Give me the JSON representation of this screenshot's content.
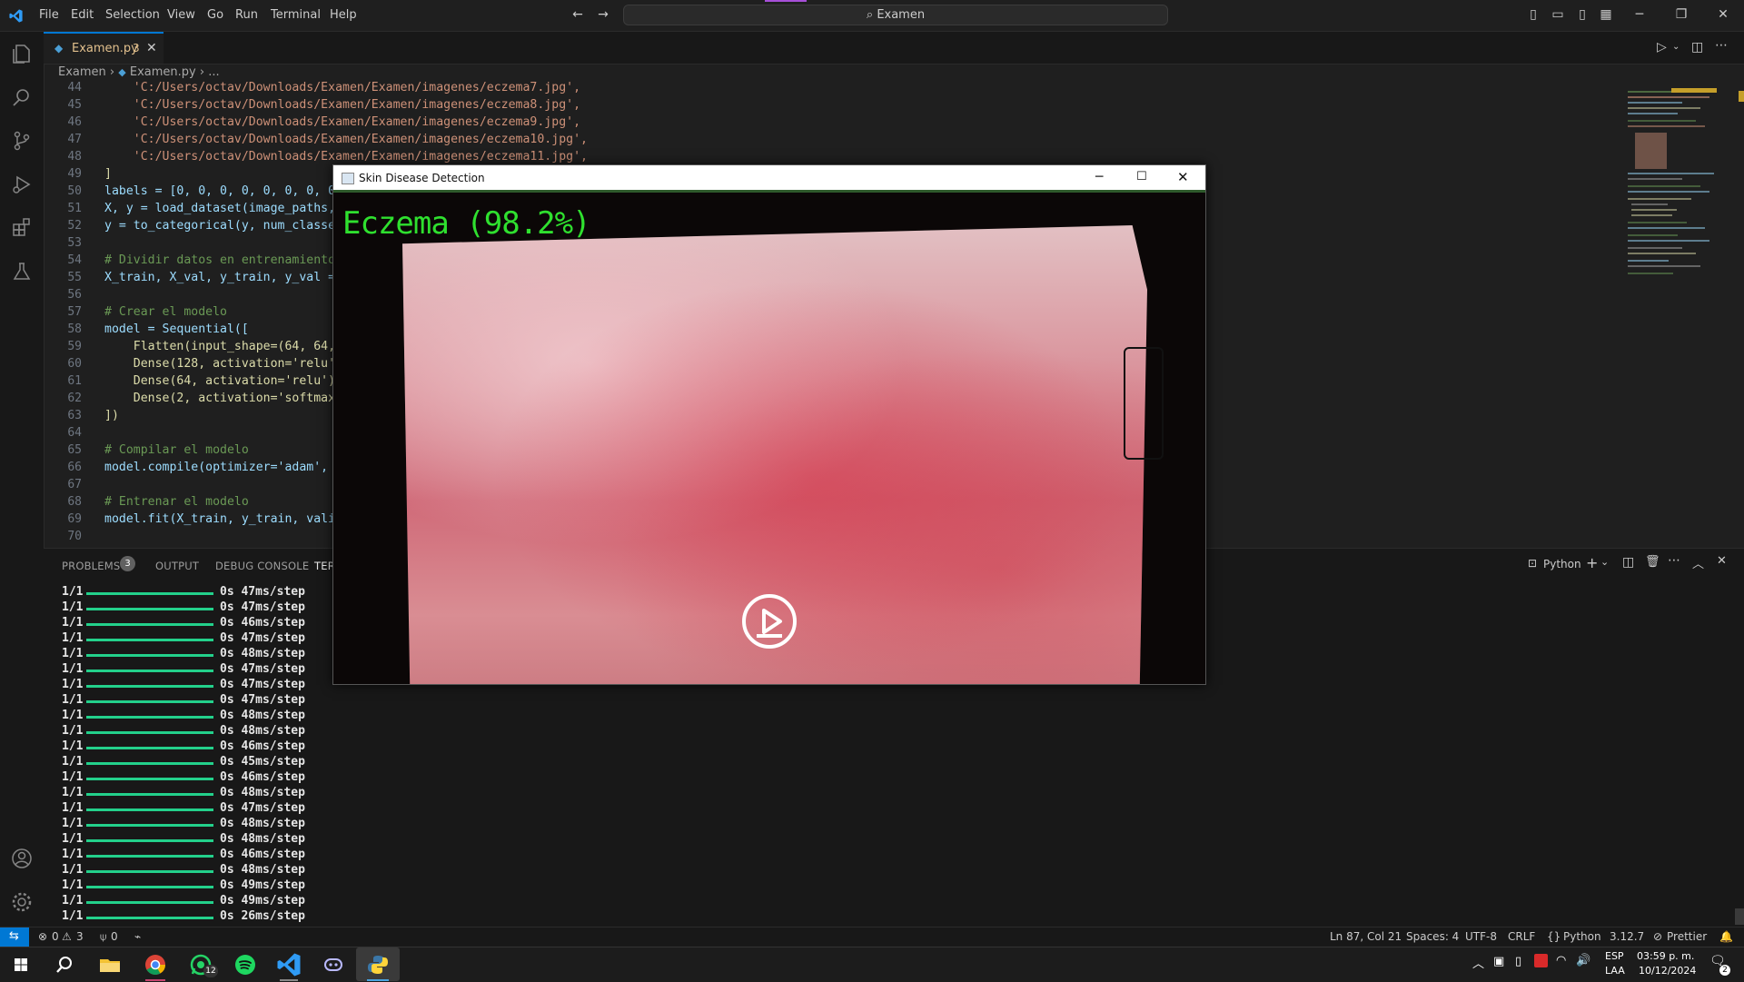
{
  "app": {
    "menu": [
      "File",
      "Edit",
      "Selection",
      "View",
      "Go",
      "Run",
      "Terminal",
      "Help"
    ],
    "search": "Examen",
    "accent": "#0078d4"
  },
  "tab": {
    "name": "Examen.py",
    "badge": "3"
  },
  "breadcrumb": {
    "folder": "Examen",
    "file": "Examen.py",
    "more": "..."
  },
  "editor": {
    "lines": [
      {
        "n": "44",
        "text": "    'C:/Users/octav/Downloads/Examen/Examen/imagenes/eczema7.jpg',",
        "cls": "str"
      },
      {
        "n": "45",
        "text": "    'C:/Users/octav/Downloads/Examen/Examen/imagenes/eczema8.jpg',",
        "cls": "str"
      },
      {
        "n": "46",
        "text": "    'C:/Users/octav/Downloads/Examen/Examen/imagenes/eczema9.jpg',",
        "cls": "str"
      },
      {
        "n": "47",
        "text": "    'C:/Users/octav/Downloads/Examen/Examen/imagenes/eczema10.jpg',",
        "cls": "str"
      },
      {
        "n": "48",
        "text": "    'C:/Users/octav/Downloads/Examen/Examen/imagenes/eczema11.jpg',",
        "cls": "str"
      },
      {
        "n": "49",
        "text": "]",
        "cls": "fn"
      },
      {
        "n": "50",
        "text": "labels = [0, 0, 0, 0, 0, 0, 0, 0,",
        "cls": "var"
      },
      {
        "n": "51",
        "text": "X, y = load_dataset(image_paths,",
        "cls": "var"
      },
      {
        "n": "52",
        "text": "y = to_categorical(y, num_classes",
        "cls": "var"
      },
      {
        "n": "53",
        "text": "",
        "cls": ""
      },
      {
        "n": "54",
        "text": "# Dividir datos en entrenamiento",
        "cls": "cm"
      },
      {
        "n": "55",
        "text": "X_train, X_val, y_train, y_val =",
        "cls": "var"
      },
      {
        "n": "56",
        "text": "",
        "cls": ""
      },
      {
        "n": "57",
        "text": "# Crear el modelo",
        "cls": "cm"
      },
      {
        "n": "58",
        "text": "model = Sequential([",
        "cls": "var"
      },
      {
        "n": "59",
        "text": "    Flatten(input_shape=(64, 64,",
        "cls": "fn"
      },
      {
        "n": "60",
        "text": "    Dense(128, activation='relu'),",
        "cls": "fn"
      },
      {
        "n": "61",
        "text": "    Dense(64, activation='relu'),",
        "cls": "fn"
      },
      {
        "n": "62",
        "text": "    Dense(2, activation='softmax'",
        "cls": "fn"
      },
      {
        "n": "63",
        "text": "])",
        "cls": "fn"
      },
      {
        "n": "64",
        "text": "",
        "cls": ""
      },
      {
        "n": "65",
        "text": "# Compilar el modelo",
        "cls": "cm"
      },
      {
        "n": "66",
        "text": "model.compile(optimizer='adam', l",
        "cls": "var"
      },
      {
        "n": "67",
        "text": "",
        "cls": ""
      },
      {
        "n": "68",
        "text": "# Entrenar el modelo",
        "cls": "cm"
      },
      {
        "n": "69",
        "text": "model.fit(X_train, y_train, valic",
        "cls": "var"
      },
      {
        "n": "70",
        "text": "",
        "cls": ""
      }
    ]
  },
  "panel": {
    "tabs": [
      "PROBLEMS",
      "OUTPUT",
      "DEBUG CONSOLE",
      "TERI"
    ],
    "problems_count": "3",
    "shell": "Python",
    "terminal_rows": [
      {
        "step": "1/1",
        "time": "0s 47ms/step"
      },
      {
        "step": "1/1",
        "time": "0s 47ms/step"
      },
      {
        "step": "1/1",
        "time": "0s 46ms/step"
      },
      {
        "step": "1/1",
        "time": "0s 47ms/step"
      },
      {
        "step": "1/1",
        "time": "0s 48ms/step"
      },
      {
        "step": "1/1",
        "time": "0s 47ms/step"
      },
      {
        "step": "1/1",
        "time": "0s 47ms/step"
      },
      {
        "step": "1/1",
        "time": "0s 47ms/step"
      },
      {
        "step": "1/1",
        "time": "0s 48ms/step"
      },
      {
        "step": "1/1",
        "time": "0s 48ms/step"
      },
      {
        "step": "1/1",
        "time": "0s 46ms/step"
      },
      {
        "step": "1/1",
        "time": "0s 45ms/step"
      },
      {
        "step": "1/1",
        "time": "0s 46ms/step"
      },
      {
        "step": "1/1",
        "time": "0s 48ms/step"
      },
      {
        "step": "1/1",
        "time": "0s 47ms/step"
      },
      {
        "step": "1/1",
        "time": "0s 48ms/step"
      },
      {
        "step": "1/1",
        "time": "0s 48ms/step"
      },
      {
        "step": "1/1",
        "time": "0s 46ms/step"
      },
      {
        "step": "1/1",
        "time": "0s 48ms/step"
      },
      {
        "step": "1/1",
        "time": "0s 49ms/step"
      },
      {
        "step": "1/1",
        "time": "0s 49ms/step"
      },
      {
        "step": "1/1",
        "time": "0s 26ms/step"
      }
    ]
  },
  "popup": {
    "title": "Skin Disease Detection",
    "prediction": "Eczema (98.2%)"
  },
  "status": {
    "errors": "0",
    "warnings": "3",
    "ports": "0",
    "position": "Ln 87, Col 21",
    "spaces": "Spaces: 4",
    "encoding": "UTF-8",
    "eol": "CRLF",
    "language": "Python",
    "version": "3.12.7",
    "formatter": "Prettier"
  },
  "taskbar": {
    "lang1": "ESP",
    "lang2": "LAA",
    "time": "03:59 p. m.",
    "date": "10/12/2024",
    "whatsapp_badge": "12",
    "notif_badge": "2"
  }
}
